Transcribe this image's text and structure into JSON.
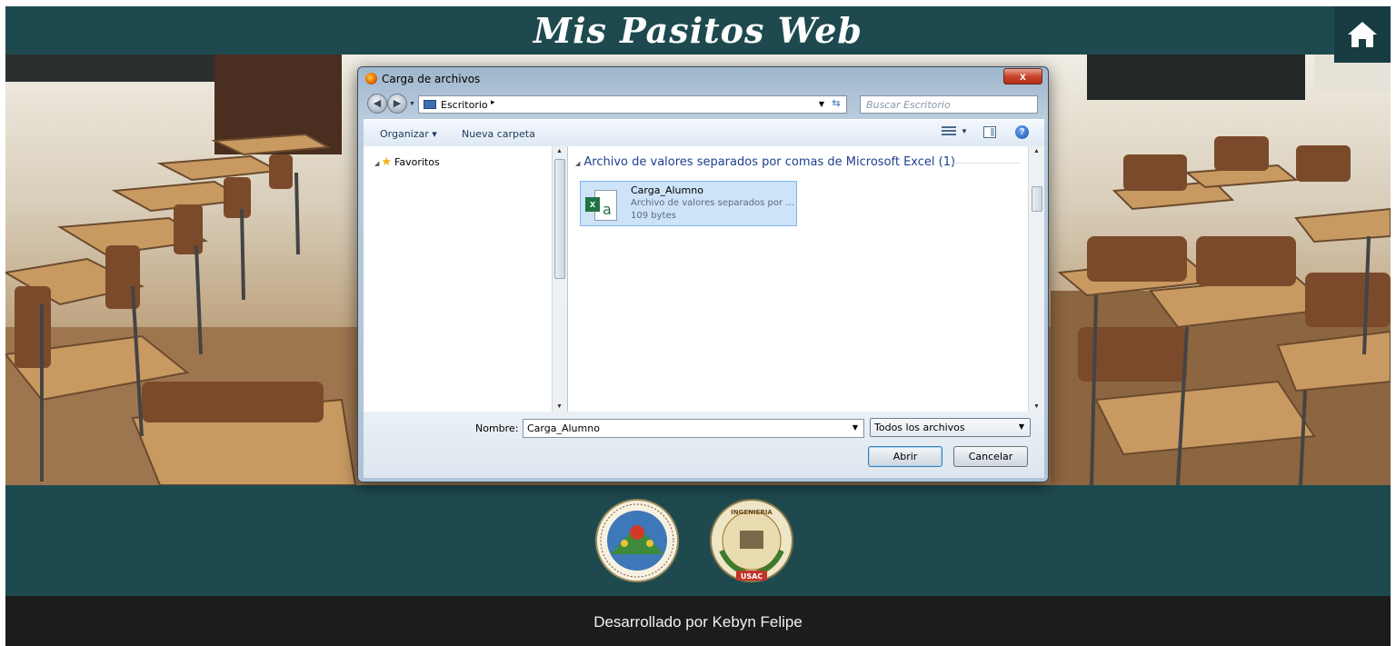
{
  "site": {
    "title": "Mis Pasitos Web",
    "home_icon": "home-icon"
  },
  "dialog": {
    "title": "Carga de archivos",
    "close_label": "x",
    "address": {
      "location": "Escritorio",
      "separator": "▸"
    },
    "search": {
      "placeholder": "Buscar Escritorio"
    },
    "toolbar": {
      "organize": "Organizar ▾",
      "new_folder": "Nueva carpeta"
    },
    "nav_pane": {
      "favorites": "Favoritos"
    },
    "group": {
      "header": "Archivo de valores separados por comas de Microsoft Excel (1)"
    },
    "files": [
      {
        "name": "Carga_Alumno",
        "type": "Archivo de valores separados por ...",
        "size": "109 bytes",
        "icon": "excel-csv-icon"
      }
    ],
    "file_name_label": "Nombre:",
    "file_name_value": "Carga_Alumno",
    "file_type_selected": "Todos los archivos",
    "open_button": "Abrir",
    "cancel_button": "Cancelar"
  },
  "footer": {
    "credit": "Desarrollado por Kebyn Felipe",
    "seals": [
      "usac-seal",
      "ingenieria-usac-seal"
    ],
    "seal_text_2": "INGENIERIA",
    "seal_text_3": "USAC"
  },
  "colors": {
    "header_bg": "#1e4a4f",
    "footer_bar_bg": "#1c1c1c",
    "accent_selection": "#cde3f8"
  }
}
